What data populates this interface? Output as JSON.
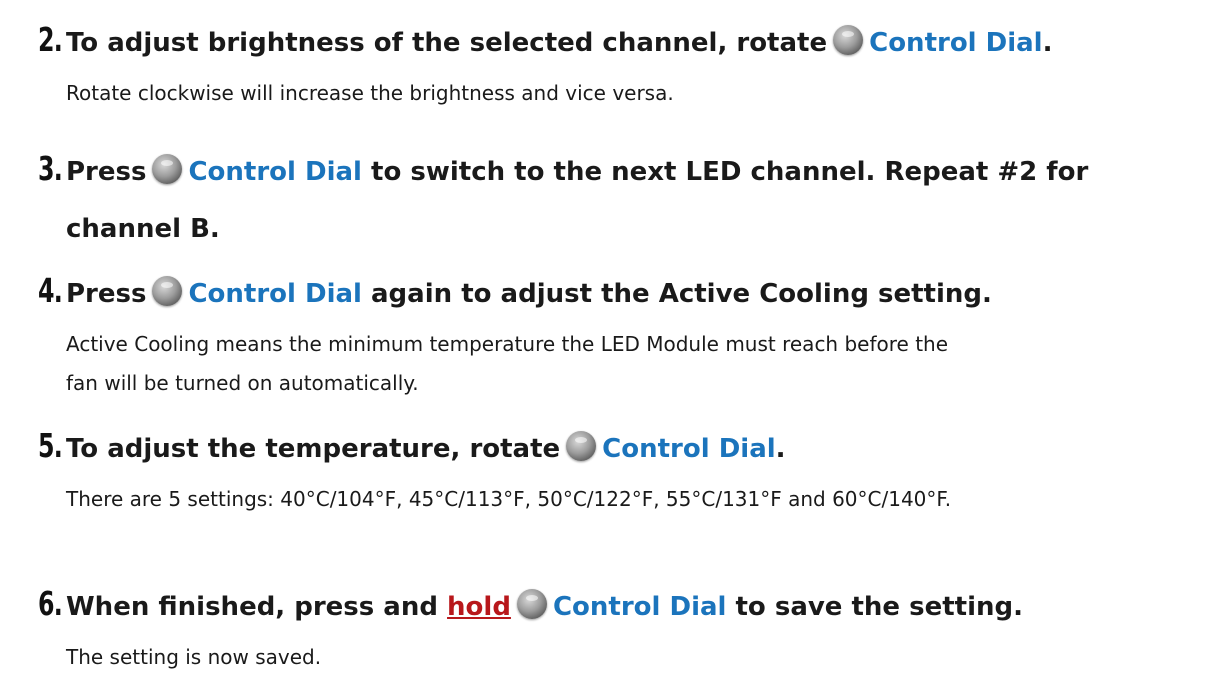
{
  "steps": [
    {
      "number": "2.",
      "heading_before": "To adjust brightness of the selected channel, rotate",
      "link": "Control Dial",
      "heading_after": ".",
      "description": "Rotate clockwise will increase the brightness and vice versa."
    },
    {
      "number": "3.",
      "heading_before": "Press",
      "link": "Control Dial",
      "heading_after": "to switch to the next LED channel. Repeat #2 for",
      "heading_line2": "channel B."
    },
    {
      "number": "4.",
      "heading_before": "Press",
      "link": "Control Dial",
      "heading_after": "again to adjust the Active Cooling setting.",
      "description_line1": "Active Cooling means the minimum temperature the LED Module must reach before the",
      "description_line2": "fan will be turned on automatically."
    },
    {
      "number": "5.",
      "heading_before": "To adjust the temperature, rotate",
      "link": "Control Dial",
      "heading_after": ".",
      "description": "There are 5 settings: 40°C/104°F, 45°C/113°F, 50°C/122°F, 55°C/131°F and 60°C/140°F."
    },
    {
      "number": "6.",
      "heading_before": "When finished, press and",
      "emphasis": "hold",
      "link": "Control Dial",
      "heading_after": "to save the setting.",
      "description": "The setting is now saved."
    }
  ],
  "icon": "control-dial-icon"
}
